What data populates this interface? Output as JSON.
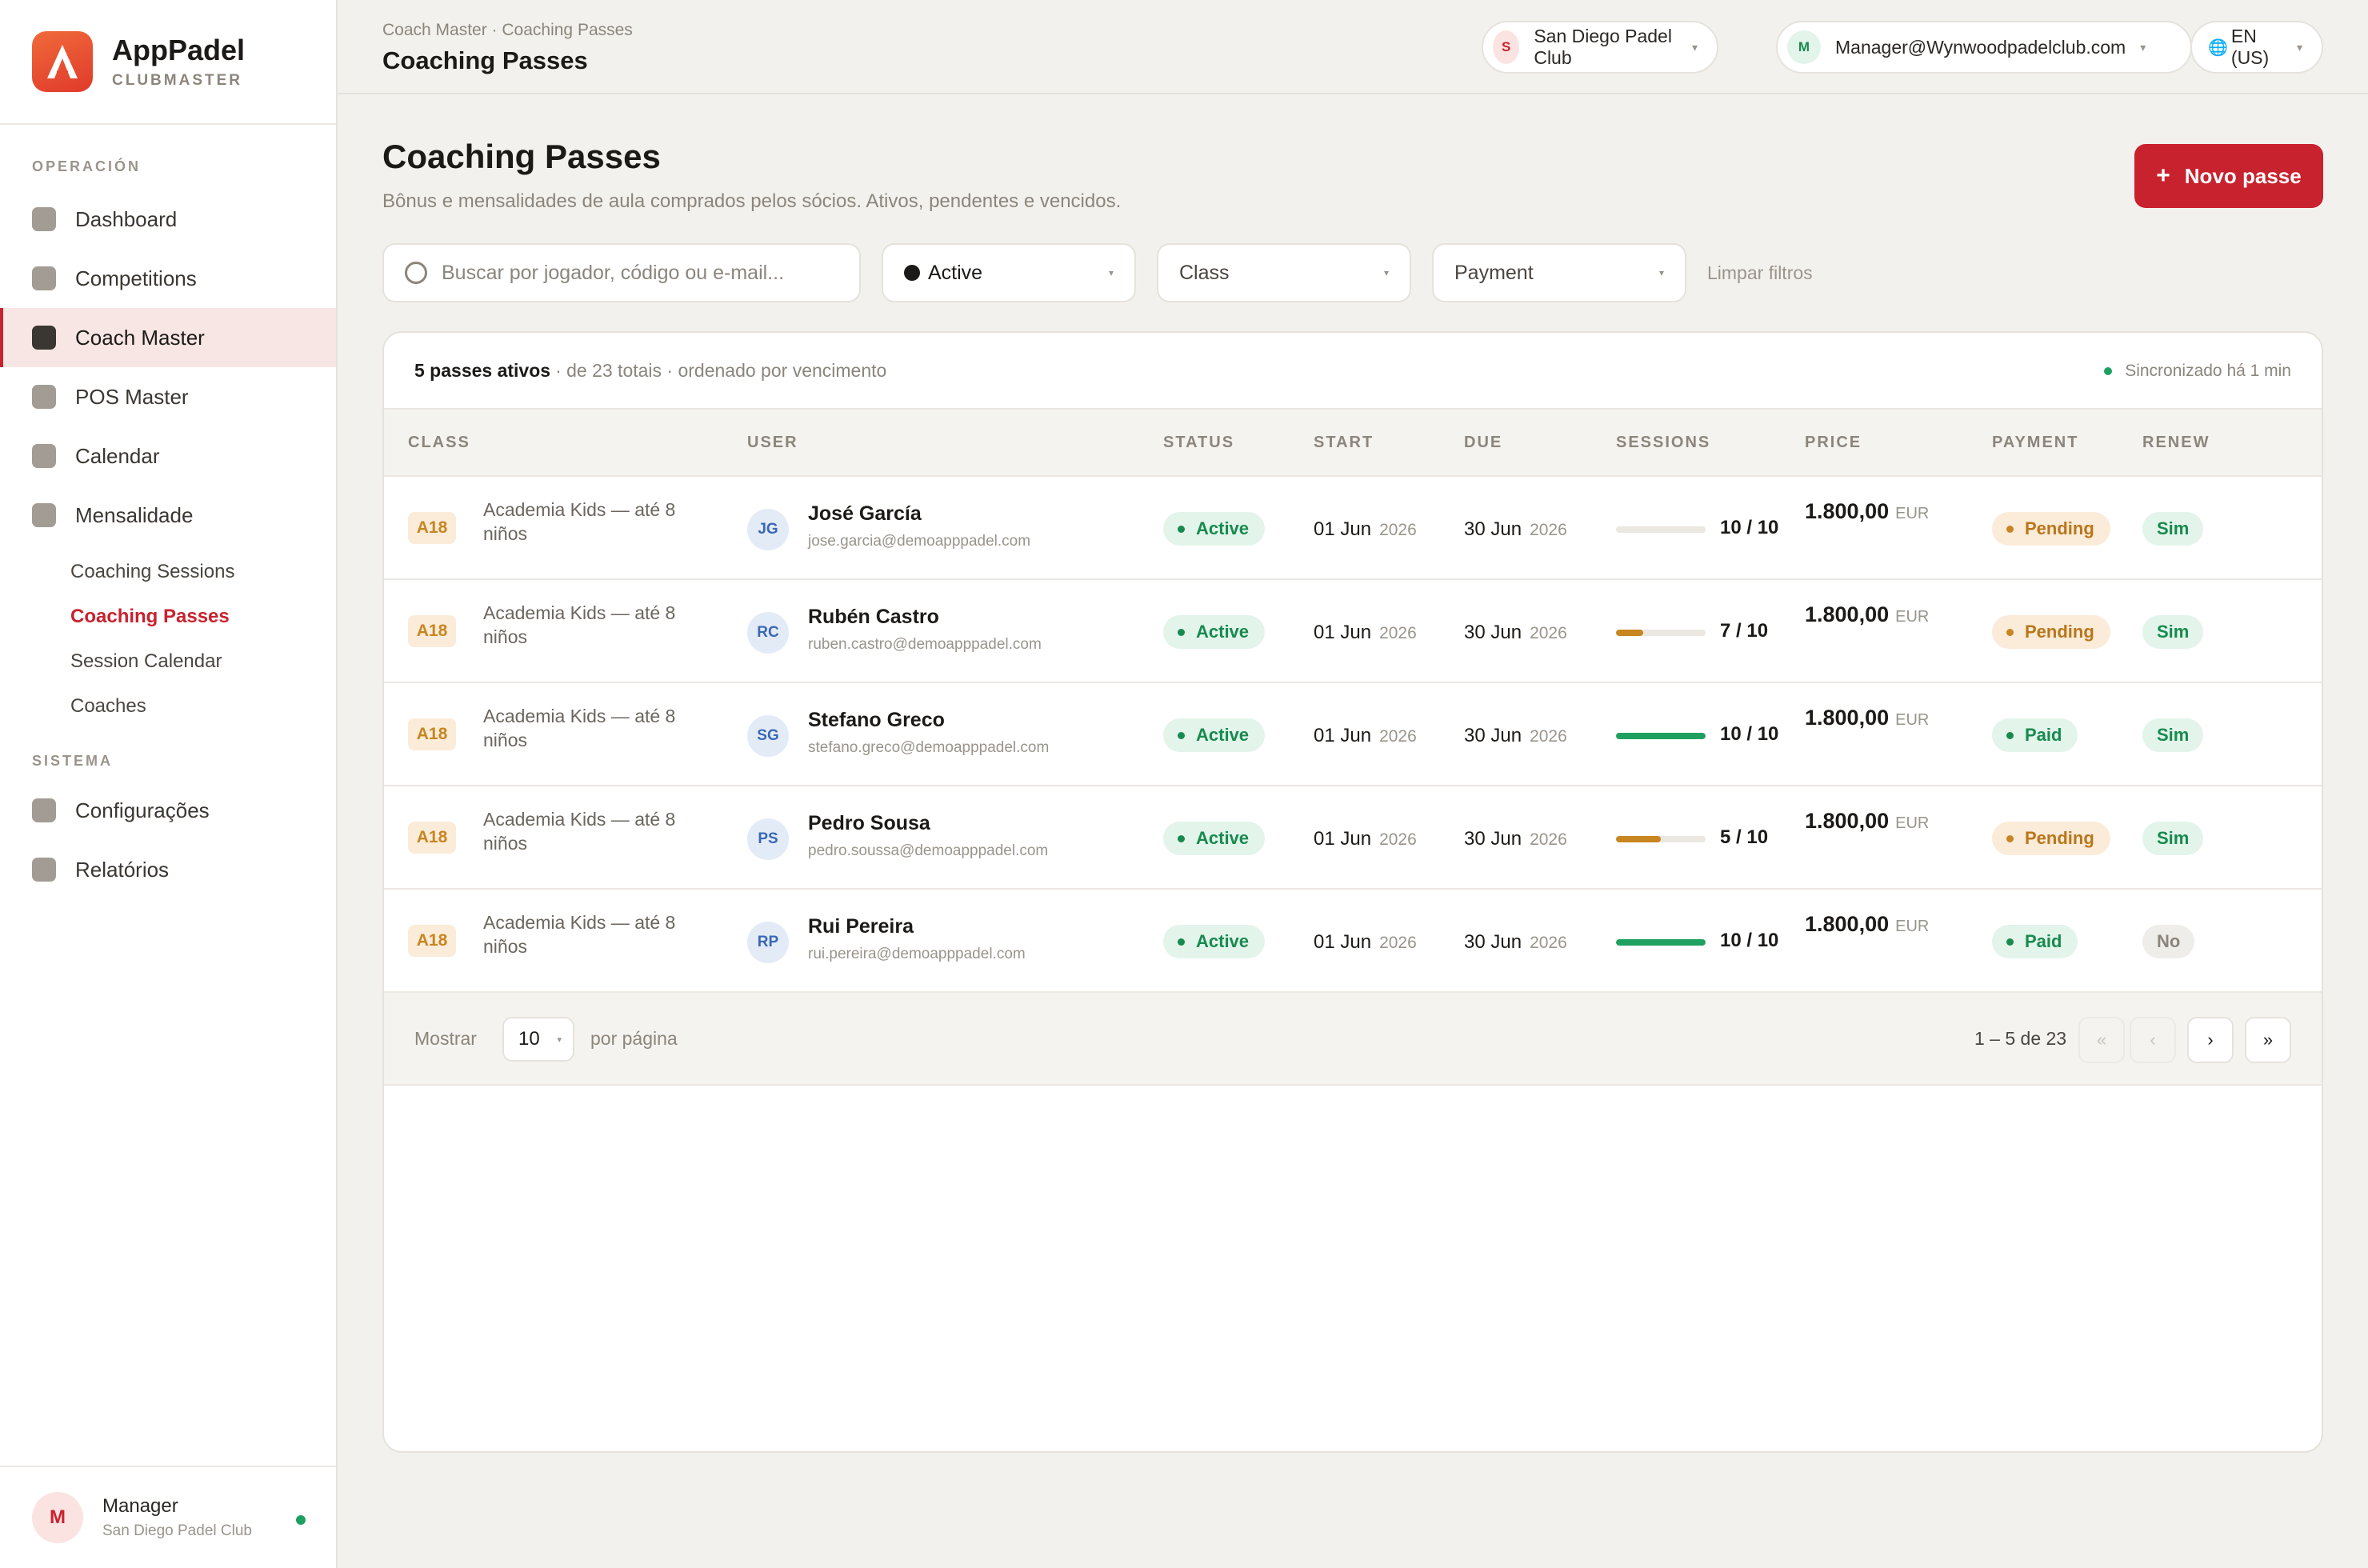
{
  "brand": {
    "name": "AppPadel",
    "sub": "CLUBMASTER"
  },
  "sidebar": {
    "section_operacao": "OPERACIÓN",
    "section_sistema": "SISTEMA",
    "items": [
      {
        "label": "Dashboard"
      },
      {
        "label": "Competitions"
      },
      {
        "label": "Coach Master"
      },
      {
        "label": "POS Master"
      },
      {
        "label": "Calendar"
      },
      {
        "label": "Mensalidade"
      }
    ],
    "sub_items": [
      {
        "label": "Coaching Sessions"
      },
      {
        "label": "Coaching Passes"
      },
      {
        "label": "Session Calendar"
      },
      {
        "label": "Coaches"
      }
    ],
    "system_items": [
      {
        "label": "Configurações"
      },
      {
        "label": "Relatórios"
      }
    ],
    "footer": {
      "initial": "M",
      "name": "Manager",
      "club": "San Diego Padel Club"
    }
  },
  "topbar": {
    "breadcrumb": "Coach Master · Coaching Passes",
    "title": "Coaching Passes",
    "club": {
      "initial": "S",
      "label": "San Diego Padel Club"
    },
    "account": {
      "initial": "M",
      "label": "Manager@Wynwoodpadelclub.com"
    },
    "language": "EN (US)"
  },
  "page": {
    "title": "Coaching Passes",
    "subtitle": "Bônus e mensalidades de aula comprados pelos sócios. Ativos, pendentes e vencidos.",
    "new_button": "Novo passe"
  },
  "filters": {
    "search_placeholder": "Buscar por jogador, código ou e-mail...",
    "status": "Active",
    "class": "Class",
    "payment": "Payment",
    "clear": "Limpar filtros"
  },
  "summary": {
    "count": "5 passes ativos",
    "meta": "· de 23 totais · ordenado por vencimento",
    "sync": "Sincronizado há 1 min"
  },
  "table": {
    "headers": [
      "CLASS",
      "USER",
      "STATUS",
      "START",
      "DUE",
      "SESSIONS",
      "PRICE",
      "PAYMENT",
      "RENEW"
    ],
    "rows": [
      {
        "class_code": "A18",
        "class_name": "Academia Kids — até 8 niños",
        "initials": "JG",
        "name": "José García",
        "email": "jose.garcia@demoapppadel.com",
        "status": "Active",
        "start": "01 Jun",
        "start_year": "2026",
        "due": "30 Jun",
        "due_year": "2026",
        "sessions": "10 / 10",
        "progress": 0.0,
        "progress_color": "#1ea060",
        "price": "1.800,00",
        "currency": "EUR",
        "payment": "Pending",
        "renew": "Sim"
      },
      {
        "class_code": "A18",
        "class_name": "Academia Kids — até 8 niños",
        "initials": "RC",
        "name": "Rubén Castro",
        "email": "ruben.castro@demoapppadel.com",
        "status": "Active",
        "start": "01 Jun",
        "start_year": "2026",
        "due": "30 Jun",
        "due_year": "2026",
        "sessions": "7 / 10",
        "progress": 0.3,
        "progress_color": "#c7861f",
        "price": "1.800,00",
        "currency": "EUR",
        "payment": "Pending",
        "renew": "Sim"
      },
      {
        "class_code": "A18",
        "class_name": "Academia Kids — até 8 niños",
        "initials": "SG",
        "name": "Stefano Greco",
        "email": "stefano.greco@demoapppadel.com",
        "status": "Active",
        "start": "01 Jun",
        "start_year": "2026",
        "due": "30 Jun",
        "due_year": "2026",
        "sessions": "10 / 10",
        "progress": 1.0,
        "progress_color": "#1ea060",
        "price": "1.800,00",
        "currency": "EUR",
        "payment": "Paid",
        "renew": "Sim"
      },
      {
        "class_code": "A18",
        "class_name": "Academia Kids — até 8 niños",
        "initials": "PS",
        "name": "Pedro Sousa",
        "email": "pedro.soussa@demoapppadel.com",
        "status": "Active",
        "start": "01 Jun",
        "start_year": "2026",
        "due": "30 Jun",
        "due_year": "2026",
        "sessions": "5 / 10",
        "progress": 0.5,
        "progress_color": "#c7861f",
        "price": "1.800,00",
        "currency": "EUR",
        "payment": "Pending",
        "renew": "Sim"
      },
      {
        "class_code": "A18",
        "class_name": "Academia Kids — até 8 niños",
        "initials": "RP",
        "name": "Rui Pereira",
        "email": "rui.pereira@demoapppadel.com",
        "status": "Active",
        "start": "01 Jun",
        "start_year": "2026",
        "due": "30 Jun",
        "due_year": "2026",
        "sessions": "10 / 10",
        "progress": 1.0,
        "progress_color": "#1ea060",
        "price": "1.800,00",
        "currency": "EUR",
        "payment": "Paid",
        "renew": "No"
      }
    ]
  },
  "pagination": {
    "show_label": "Mostrar",
    "per_page": "10",
    "per_page_label": "por página",
    "range": "1 – 5 de 23",
    "first": "«",
    "prev": "‹",
    "next": "›",
    "last": "»"
  },
  "colors": {
    "accent": "#c8222e",
    "success": "#1ea060",
    "warning": "#c7861f"
  }
}
